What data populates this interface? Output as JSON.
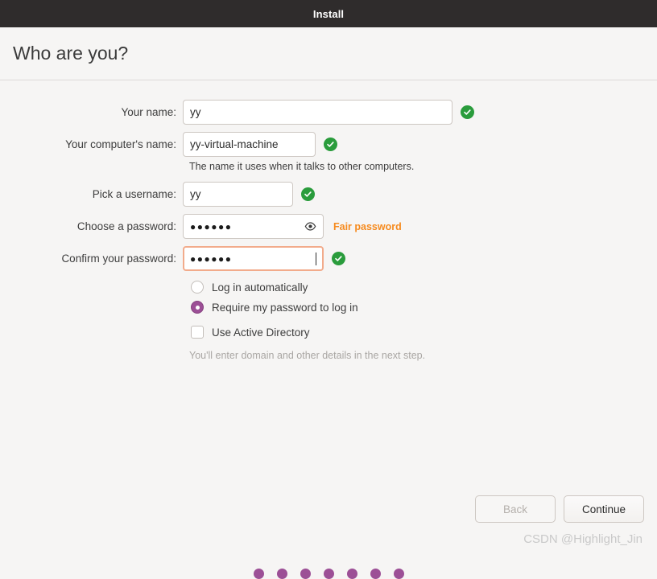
{
  "window": {
    "title": "Install"
  },
  "header": {
    "title": "Who are you?"
  },
  "form": {
    "name": {
      "label": "Your name:",
      "value": "yy",
      "valid_icon": "check-circle-icon"
    },
    "hostname": {
      "label": "Your computer's name:",
      "value": "yy-virtual-machine",
      "hint": "The name it uses when it talks to other computers.",
      "valid_icon": "check-circle-icon"
    },
    "username": {
      "label": "Pick a username:",
      "value": "yy",
      "valid_icon": "check-circle-icon"
    },
    "password": {
      "label": "Choose a password:",
      "value": "●●●●●●",
      "reveal_icon": "eye-icon",
      "strength": "Fair password"
    },
    "confirm_password": {
      "label": "Confirm your password:",
      "value": "●●●●●●",
      "valid_icon": "check-circle-icon",
      "focused": true
    }
  },
  "options": {
    "login_auto": {
      "label": "Log in automatically",
      "selected": false
    },
    "require_password": {
      "label": "Require my password to log in",
      "selected": true
    },
    "active_directory": {
      "label": "Use Active Directory",
      "checked": false,
      "hint": "You'll enter domain and other details in the next step."
    }
  },
  "footer": {
    "back_label": "Back",
    "continue_label": "Continue",
    "progress_dots": 7
  },
  "watermark": {
    "text": "CSDN @Highlight_Jin"
  },
  "colors": {
    "titlebar": "#2f2c2c",
    "accent_purple": "#9c4f96",
    "valid_green": "#2a9c3c",
    "warning_orange": "#f68b1f",
    "focus_border": "#f2ab8b"
  }
}
